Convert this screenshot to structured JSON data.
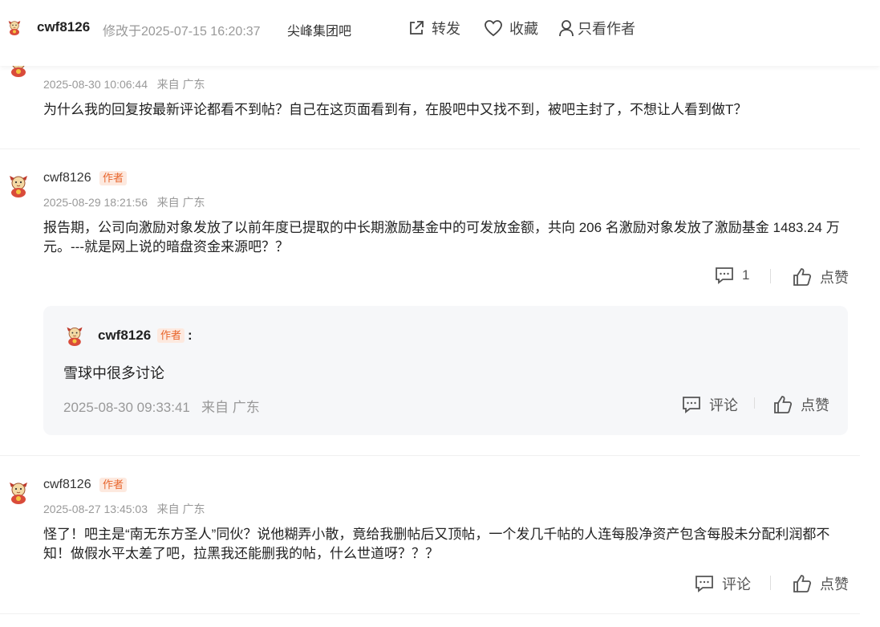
{
  "header": {
    "author": "cwf8126",
    "modified": "修改于2025-07-15 16:20:37",
    "bar_name": "尖峰集团吧",
    "share_label": "转发",
    "favorite_label": "收藏",
    "author_only_label": "只看作者"
  },
  "posts": [
    {
      "time": "2025-08-30 10:06:44",
      "location": "来自 广东",
      "content": "为什么我的回复按最新评论都看不到帖？自己在这页面看到有，在股吧中又找不到，被吧主封了，不想让人看到做T？"
    },
    {
      "username": "cwf8126",
      "tag": "作者",
      "time": "2025-08-29 18:21:56",
      "location": "来自 广东",
      "content": "报告期，公司向激励对象发放了以前年度已提取的中长期激励基金中的可发放金额，共向 206 名激励对象发放了激励基金 1483.24 万元。---就是网上说的暗盘资金来源吧？？",
      "comment_count": "1",
      "like_label": "点赞",
      "reply": {
        "username": "cwf8126",
        "tag": "作者",
        "colon": ":",
        "text": "雪球中很多讨论",
        "time": "2025-08-30 09:33:41",
        "location": "来自 广东",
        "comment_label": "评论",
        "like_label": "点赞"
      }
    },
    {
      "username": "cwf8126",
      "tag": "作者",
      "time": "2025-08-27 13:45:03",
      "location": "来自 广东",
      "content": "怪了！吧主是“南无东方圣人”同伙？说他糊弄小散，竟给我删帖后又顶帖，一个发几千帖的人连每股净资产包含每股未分配利润都不知！做假水平太差了吧，拉黑我还能删我的帖，什么世道呀？？？",
      "comment_label": "评论",
      "like_label": "点赞"
    }
  ],
  "colors": {
    "tag_text": "#e8652c",
    "tag_bg": "#fde9df",
    "reply_bg": "#f6f7f9"
  }
}
